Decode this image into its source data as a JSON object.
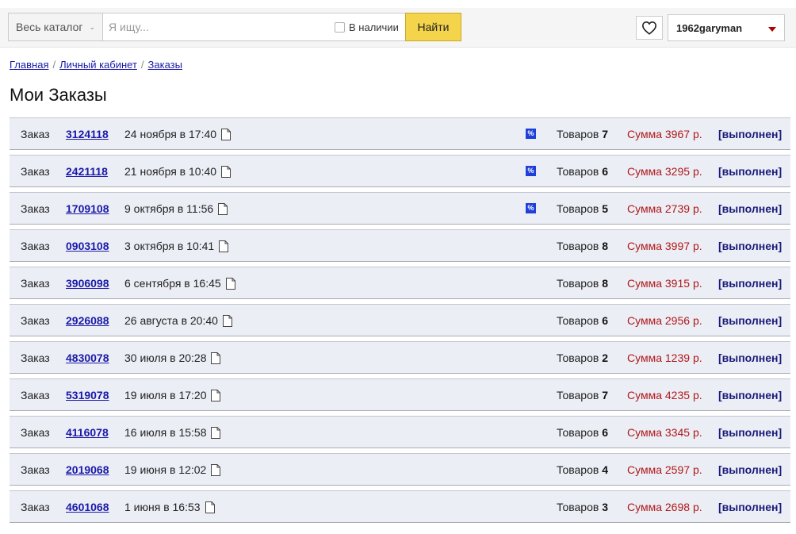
{
  "header": {
    "catalog_label": "Весь каталог",
    "search_placeholder": "Я ищу...",
    "in_stock_label": "В наличии",
    "find_label": "Найти",
    "username": "1962garyman"
  },
  "breadcrumb": [
    "Главная",
    "Личный кабинет",
    "Заказы"
  ],
  "page_title": "Мои Заказы",
  "order_label": "Заказ",
  "items_label": "Товаров",
  "sum_label": "Сумма",
  "currency": "р.",
  "discount_badge": "%",
  "orders": [
    {
      "number": "3124118",
      "date": "24 ноября в 17:40",
      "discount": true,
      "items": "7",
      "sum": "3967",
      "status": "[выполнен]"
    },
    {
      "number": "2421118",
      "date": "21 ноября в 10:40",
      "discount": true,
      "items": "6",
      "sum": "3295",
      "status": "[выполнен]"
    },
    {
      "number": "1709108",
      "date": "9 октября в 11:56",
      "discount": true,
      "items": "5",
      "sum": "2739",
      "status": "[выполнен]"
    },
    {
      "number": "0903108",
      "date": "3 октября в 10:41",
      "discount": false,
      "items": "8",
      "sum": "3997",
      "status": "[выполнен]"
    },
    {
      "number": "3906098",
      "date": "6 сентября в 16:45",
      "discount": false,
      "items": "8",
      "sum": "3915",
      "status": "[выполнен]"
    },
    {
      "number": "2926088",
      "date": "26 августа в 20:40",
      "discount": false,
      "items": "6",
      "sum": "2956",
      "status": "[выполнен]"
    },
    {
      "number": "4830078",
      "date": "30 июля в 20:28",
      "discount": false,
      "items": "2",
      "sum": "1239",
      "status": "[выполнен]"
    },
    {
      "number": "5319078",
      "date": "19 июля в 17:20",
      "discount": false,
      "items": "7",
      "sum": "4235",
      "status": "[выполнен]"
    },
    {
      "number": "4116078",
      "date": "16 июля в 15:58",
      "discount": false,
      "items": "6",
      "sum": "3345",
      "status": "[выполнен]"
    },
    {
      "number": "2019068",
      "date": "19 июня в 12:02",
      "discount": false,
      "items": "4",
      "sum": "2597",
      "status": "[выполнен]"
    },
    {
      "number": "4601068",
      "date": "1 июня в 16:53",
      "discount": false,
      "items": "3",
      "sum": "2698",
      "status": "[выполнен]"
    }
  ],
  "colors": {
    "accent_button": "#f4d44a",
    "link": "#1a1aa8",
    "sum": "#b01818",
    "status": "#1a1a7a",
    "row_bg": "#eceef6",
    "discount_badge": "#1e3fd8"
  }
}
